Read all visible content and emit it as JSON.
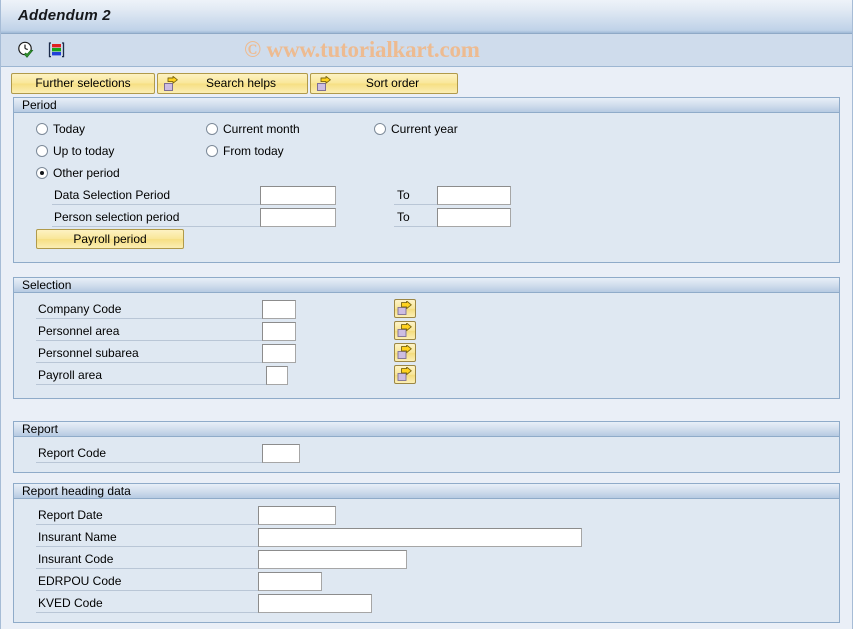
{
  "window": {
    "title": "Addendum 2"
  },
  "toolbar": {
    "icons": [
      {
        "name": "execute-clock-icon",
        "title": "Execute with schedule"
      },
      {
        "name": "variant-icon",
        "title": "Get variant"
      }
    ],
    "watermark": "© www.tutorialkart.com"
  },
  "buttons": {
    "further_selections": "Further selections",
    "search_helps": "Search helps",
    "sort_order": "Sort order"
  },
  "sections": {
    "period": {
      "header": "Period",
      "radios": [
        {
          "label": "Today",
          "selected": false
        },
        {
          "label": "Current month",
          "selected": false
        },
        {
          "label": "Current year",
          "selected": false
        },
        {
          "label": "Up to today",
          "selected": false
        },
        {
          "label": "From today",
          "selected": false
        },
        {
          "label": "Other period",
          "selected": true
        }
      ],
      "fields": [
        {
          "label": "Data Selection Period",
          "value": "",
          "to_label": "To",
          "to_value": ""
        },
        {
          "label": "Person selection period",
          "value": "",
          "to_label": "To",
          "to_value": ""
        }
      ],
      "payroll_button": "Payroll period"
    },
    "selection": {
      "header": "Selection",
      "fields": [
        {
          "label": "Company Code",
          "value": ""
        },
        {
          "label": "Personnel area",
          "value": ""
        },
        {
          "label": "Personnel subarea",
          "value": ""
        },
        {
          "label": "Payroll area",
          "value": ""
        }
      ]
    },
    "report": {
      "header": "Report",
      "fields": [
        {
          "label": "Report Code",
          "value": ""
        }
      ]
    },
    "report_heading": {
      "header": "Report heading data",
      "fields": [
        {
          "label": "Report Date",
          "value": ""
        },
        {
          "label": "Insurant Name",
          "value": ""
        },
        {
          "label": "Insurant Code",
          "value": ""
        },
        {
          "label": "EDRPOU Code",
          "value": ""
        },
        {
          "label": "KVED Code",
          "value": ""
        }
      ]
    }
  },
  "colors": {
    "panel_background": "#dfe8f2",
    "panel_header": "#cfdcec",
    "button_yellow": "#f9e79a",
    "watermark": "#f0b98a",
    "window_background": "#eaeff7"
  }
}
